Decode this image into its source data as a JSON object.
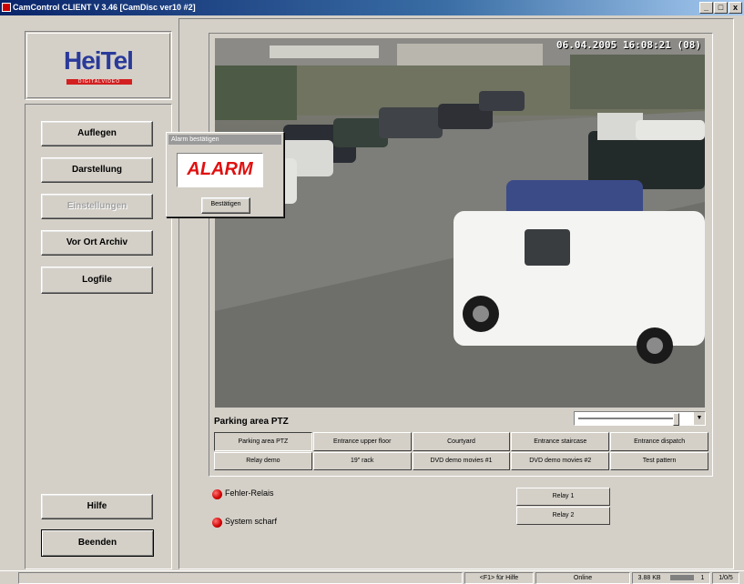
{
  "window": {
    "title": "CamControl CLIENT   V 3.46  [CamDisc ver10 #2]",
    "controls": [
      "_",
      "□",
      "x"
    ]
  },
  "logo": {
    "name": "HeiTel",
    "tagline": "DIGITALVIDEO"
  },
  "sidebar": {
    "buttons": [
      {
        "label": "Auflegen",
        "enabled": true
      },
      {
        "label": "Darstellung",
        "enabled": true
      },
      {
        "label": "Einstellungen",
        "enabled": false
      },
      {
        "label": "Vor Ort Archiv",
        "enabled": true
      },
      {
        "label": "Logfile",
        "enabled": true
      }
    ],
    "help_label": "Hilfe",
    "exit_label": "Beenden"
  },
  "dialog": {
    "title": "Alarm bestätigen",
    "alarm_text": "ALARM",
    "confirm_label": "Bestätigen"
  },
  "video": {
    "timestamp": "06.04.2005 16:08:21 (08)",
    "camera_label": "Parking area PTZ"
  },
  "cameras": [
    {
      "label": "Parking area PTZ",
      "selected": true
    },
    {
      "label": "Entrance upper floor"
    },
    {
      "label": "Courtyard"
    },
    {
      "label": "Entrance staircase"
    },
    {
      "label": "Entrance dispatch"
    },
    {
      "label": "Relay demo"
    },
    {
      "label": "19\" rack"
    },
    {
      "label": "DVD demo movies #1"
    },
    {
      "label": "DVD demo movies #2"
    },
    {
      "label": "Test pattern"
    }
  ],
  "status_indicators": [
    {
      "label": "Fehler-Relais",
      "color": "#d00000"
    },
    {
      "label": "System scharf",
      "color": "#d00000"
    }
  ],
  "relays": [
    "Relay 1",
    "Relay 2"
  ],
  "statusbar": {
    "help": "<F1> für Hilfe",
    "connection": "Online",
    "size": "3.88 KB",
    "count": "1",
    "pages": "1/0/5"
  },
  "colors": {
    "accent": "#0a246a",
    "alarm": "#e01010",
    "logo": "#2a3a9a"
  }
}
